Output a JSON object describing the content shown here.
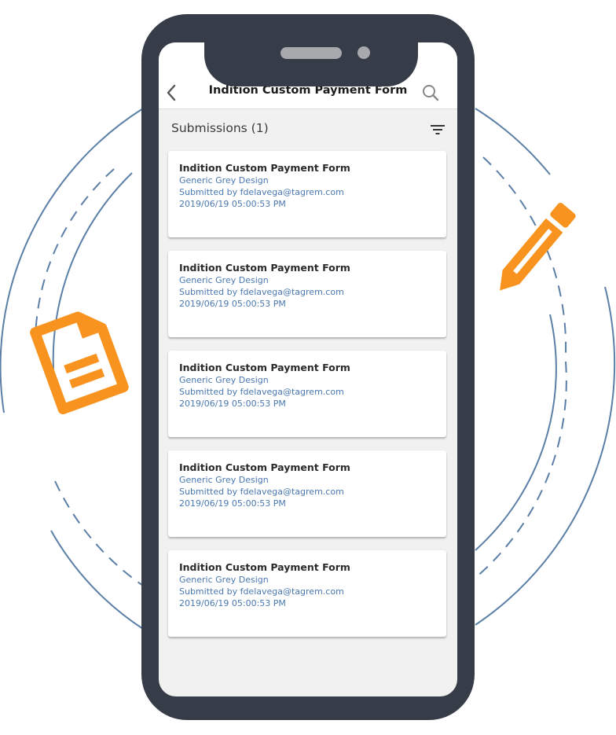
{
  "app_bar": {
    "title": "Indition Custom Payment Form",
    "back_icon": "chevron-left-icon",
    "search_icon": "search-icon"
  },
  "submissions": {
    "header": "Submissions (1)",
    "filter_icon": "filter-icon",
    "items": [
      {
        "form_name": "Indition Custom Payment Form",
        "design": "Generic Grey Design",
        "submitted_by": "Submitted by fdelavega@tagrem.com",
        "timestamp": "2019/06/19 05:00:53 PM"
      },
      {
        "form_name": "Indition Custom Payment Form",
        "design": "Generic Grey Design",
        "submitted_by": "Submitted by fdelavega@tagrem.com",
        "timestamp": "2019/06/19 05:00:53 PM"
      },
      {
        "form_name": "Indition Custom Payment Form",
        "design": "Generic Grey Design",
        "submitted_by": "Submitted by fdelavega@tagrem.com",
        "timestamp": "2019/06/19 05:00:53 PM"
      },
      {
        "form_name": "Indition Custom Payment Form",
        "design": "Generic Grey Design",
        "submitted_by": "Submitted by fdelavega@tagrem.com",
        "timestamp": "2019/06/19 05:00:53 PM"
      },
      {
        "form_name": "Indition Custom Payment Form",
        "design": "Generic Grey Design",
        "submitted_by": "Submitted by fdelavega@tagrem.com",
        "timestamp": "2019/06/19 05:00:53 PM"
      }
    ]
  },
  "colors": {
    "phone_frame": "#373d48",
    "accent_orange": "#f7931e",
    "ring_blue": "#5b7fa6",
    "link_blue": "#4a78b0",
    "screen_bg": "#f1f1f1"
  },
  "decorations": {
    "left_icon": "document-icon",
    "right_icon": "pencil-icon"
  }
}
